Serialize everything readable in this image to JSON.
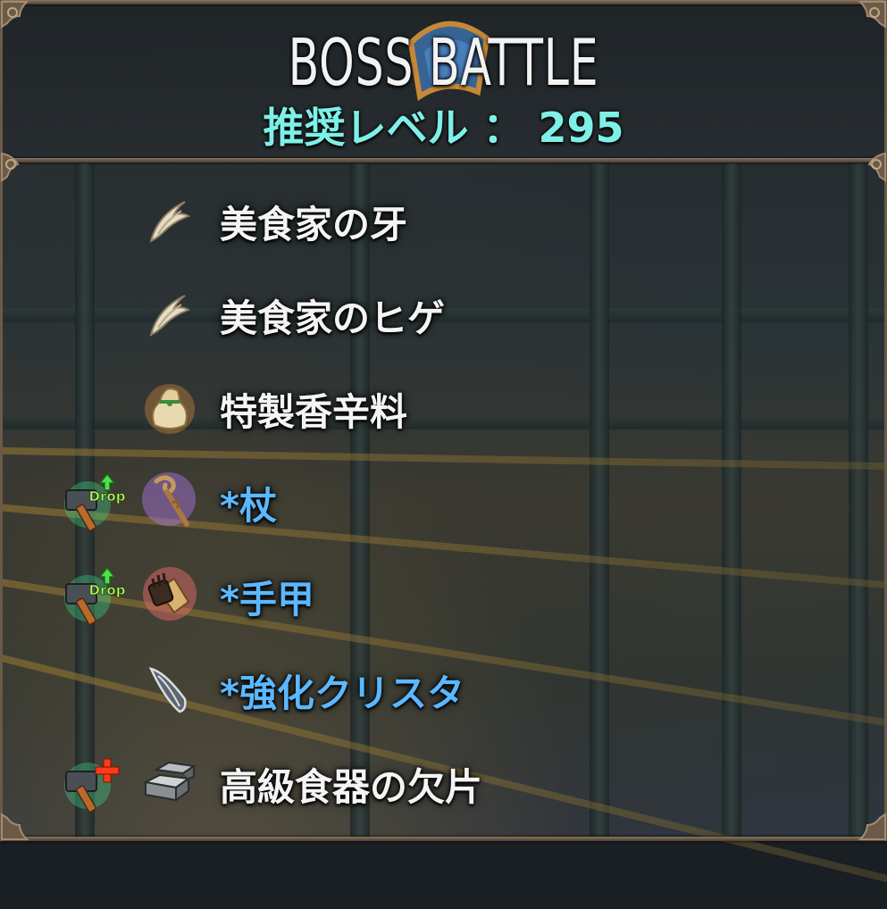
{
  "header": {
    "title": "BOSS BATTLE",
    "level_text": "推奨レベル ： 295"
  },
  "items": [
    {
      "label": "美食家の牙",
      "color": "white",
      "icon": "fang-icon",
      "badge": null
    },
    {
      "label": "美食家のヒゲ",
      "color": "white",
      "icon": "fang-icon",
      "badge": null
    },
    {
      "label": "特製香辛料",
      "color": "white",
      "icon": "spice-bag-icon",
      "badge": null
    },
    {
      "label": "*杖",
      "color": "blue",
      "icon": "staff-icon",
      "badge": {
        "icon": "hammer-drop-icon",
        "text": "Drop"
      }
    },
    {
      "label": "*手甲",
      "color": "blue",
      "icon": "gauntlet-icon",
      "badge": {
        "icon": "hammer-drop-icon",
        "text": "Drop"
      }
    },
    {
      "label": "*強化クリスタ",
      "color": "blue",
      "icon": "crystal-icon",
      "badge": null
    },
    {
      "label": "高級食器の欠片",
      "color": "white",
      "icon": "metal-ingot-icon",
      "badge": {
        "icon": "hammer-plus-icon",
        "text": ""
      }
    }
  ],
  "colors": {
    "title": "#f2f2f2",
    "level": "#7ff0e8",
    "item_white": "#f4f4f4",
    "item_blue": "#5bb8ff",
    "frame": "#8a7560"
  }
}
